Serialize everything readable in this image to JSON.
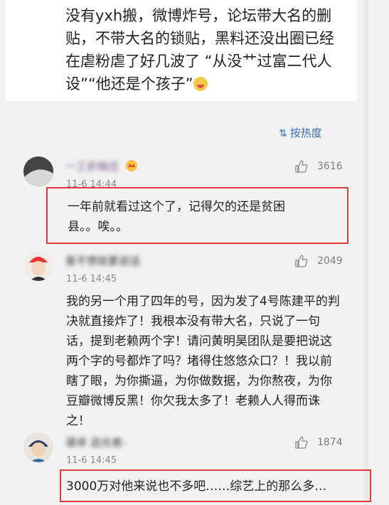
{
  "post": {
    "text": "没有yxh搬，微博炸号，论坛带大名的删贴，不带大名的锁贴，黑料还没出圈已经在虐粉虐了好几波了 “从没艹过富二代人设”“他还是个孩子”"
  },
  "sort": {
    "label": "按热度"
  },
  "comments": [
    {
      "name": "一工折梅还",
      "time": "11-6 14:44",
      "likes": "3616",
      "text": "一年前就看过这个了，记得欠的还是贫困县。。唉。。"
    },
    {
      "name": "看不惯就要说话",
      "time": "11-6 14:45",
      "likes": "2049",
      "text": "我的另一个用了四年的号，因为发了4号陈建平的判决就直接炸了！我根本没有带大名，只说了一句话，提到老赖两个字！请问黄明昊团队是要把说这两个字的号都炸了吗？堵得住悠悠众口？！我以前瞎了眼，为你撕逼，为你做数据，为你熬夜，为你豆瓣微博反黑！你欠我太多了！老赖人人得而诛之！"
    },
    {
      "name": "凝卓 追光者-",
      "time": "11-6 14:45",
      "likes": "1874",
      "text": "3000万对他来说也不多吧……综艺上的那么多…"
    }
  ],
  "colors": {
    "highlight": "#e03a3a",
    "link": "#3a6db5"
  }
}
